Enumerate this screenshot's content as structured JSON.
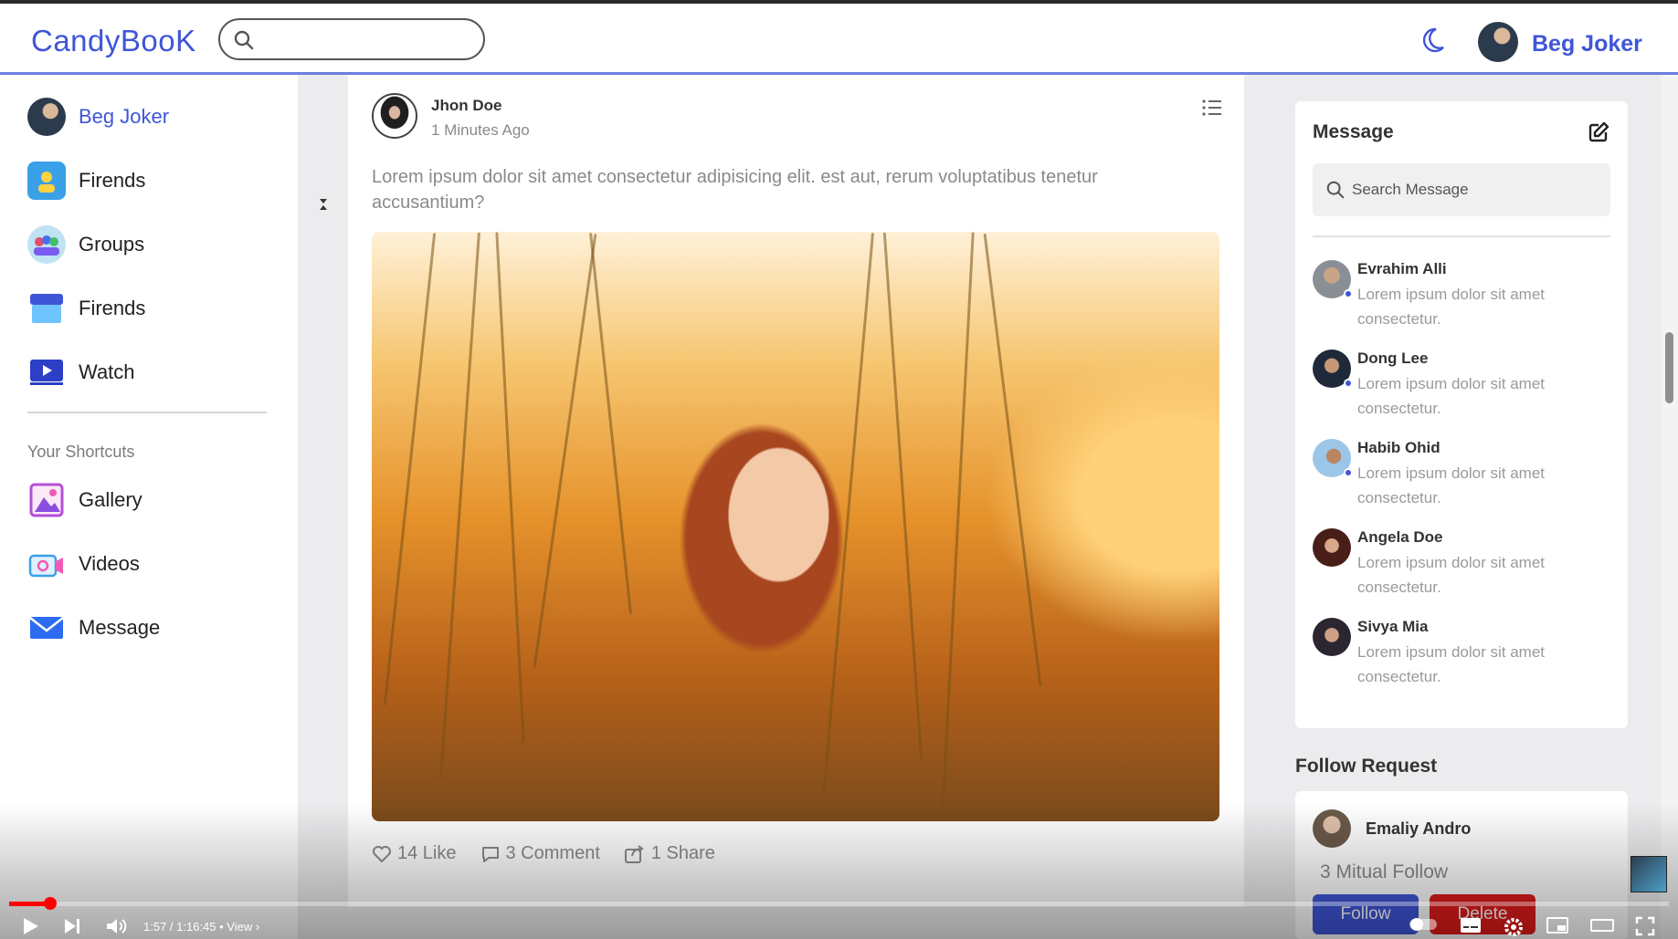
{
  "header": {
    "logo_part1": "Candy",
    "logo_part2": "BooK",
    "user_name": "Beg Joker"
  },
  "sidebar": {
    "items": [
      {
        "label": "Beg Joker"
      },
      {
        "label": "Firends"
      },
      {
        "label": "Groups"
      },
      {
        "label": "Firends"
      },
      {
        "label": "Watch"
      }
    ],
    "shortcuts_title": "Your Shortcuts",
    "shortcuts": [
      {
        "label": "Gallery"
      },
      {
        "label": "Videos"
      },
      {
        "label": "Message"
      }
    ]
  },
  "post": {
    "author": "Jhon Doe",
    "time": "1 Minutes Ago",
    "text": "Lorem ipsum dolor sit amet consectetur adipisicing elit. est aut, rerum voluptatibus tenetur accusantium?",
    "likes": "14 Like",
    "comments": "3 Comment",
    "shares": "1 Share"
  },
  "messages": {
    "title": "Message",
    "search_placeholder": "Search Message",
    "items": [
      {
        "name": "Evrahim Alli",
        "text": "Lorem ipsum dolor sit amet consectetur."
      },
      {
        "name": "Dong Lee",
        "text": "Lorem ipsum dolor sit amet consectetur."
      },
      {
        "name": "Habib Ohid",
        "text": "Lorem ipsum dolor sit amet consectetur."
      },
      {
        "name": "Angela Doe",
        "text": "Lorem ipsum dolor sit amet consectetur."
      },
      {
        "name": "Sivya Mia",
        "text": "Lorem ipsum dolor sit amet consectetur."
      }
    ]
  },
  "follow_request": {
    "title": "Follow Request",
    "name": "Emaliy Andro",
    "mutual": "3 Mitual Follow",
    "follow_label": "Follow",
    "delete_label": "Delete"
  },
  "player": {
    "time": "1:57 / 1:16:45",
    "view_label": "View",
    "progress": 0.025
  },
  "colors": {
    "accent": "#3f55d8",
    "delete": "#e11b1b",
    "progress": "#ff0000"
  }
}
